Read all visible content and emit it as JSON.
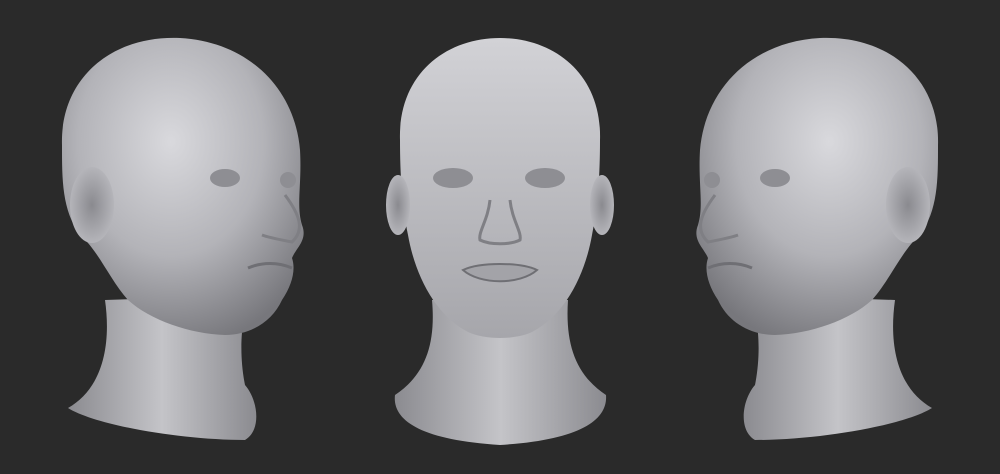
{
  "image": {
    "subject": "three-views-of-bald-female-head-sculpt",
    "views": [
      "three-quarter-left",
      "front",
      "three-quarter-right"
    ]
  },
  "colors": {
    "background": "#2a2a2a",
    "clay_light": "#cfcfd3",
    "clay_mid": "#a9a9ae",
    "clay_dark": "#6f6f74",
    "clay_shadow": "#4a4a4e"
  }
}
